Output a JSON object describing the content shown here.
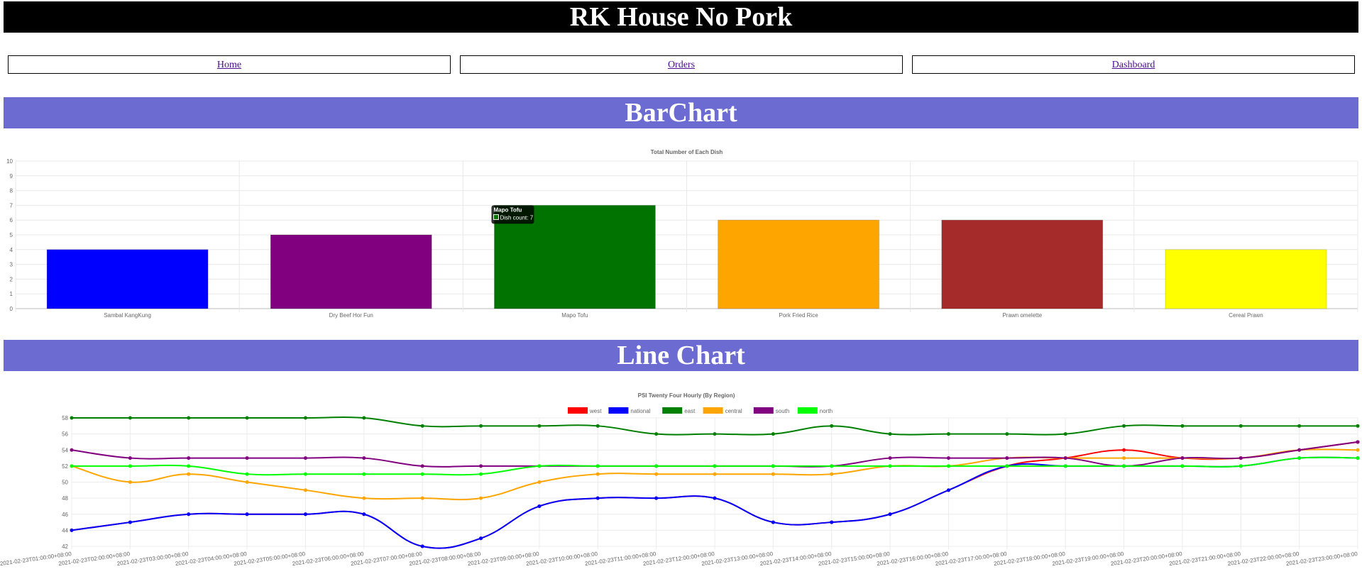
{
  "header": {
    "title": "RK House No Pork"
  },
  "nav": {
    "items": [
      {
        "label": "Home"
      },
      {
        "label": "Orders"
      },
      {
        "label": "Dashboard"
      }
    ]
  },
  "sections": {
    "bar_title": "BarChart",
    "line_title": "Line Chart"
  },
  "chart_data": [
    {
      "type": "bar",
      "title": "Total Number of Each Dish",
      "categories": [
        "Sambal KangKung",
        "Dry Beef Hor Fun",
        "Mapo Tofu",
        "Pork Fried Rice",
        "Prawn omelette",
        "Cereal Prawn"
      ],
      "series": [
        {
          "values": [
            4,
            5,
            7,
            6,
            6,
            4
          ]
        }
      ],
      "colors": [
        "#0000ff",
        "#800080",
        "#007300",
        "#ffa500",
        "#a52a2a",
        "#ffff00"
      ],
      "ylim": [
        0,
        10
      ],
      "yticks": [
        0,
        1,
        2,
        3,
        4,
        5,
        6,
        7,
        8,
        9,
        10
      ],
      "grid": true,
      "tooltip": {
        "title": "Mapo Tofu",
        "label": "Dish count: 7"
      }
    },
    {
      "type": "line",
      "title": "PSI Twenty Four Hourly (By Region)",
      "x": [
        "2021-02-23T01:00:00+08:00",
        "2021-02-23T02:00:00+08:00",
        "2021-02-23T03:00:00+08:00",
        "2021-02-23T04:00:00+08:00",
        "2021-02-23T05:00:00+08:00",
        "2021-02-23T06:00:00+08:00",
        "2021-02-23T07:00:00+08:00",
        "2021-02-23T08:00:00+08:00",
        "2021-02-23T09:00:00+08:00",
        "2021-02-23T10:00:00+08:00",
        "2021-02-23T11:00:00+08:00",
        "2021-02-23T12:00:00+08:00",
        "2021-02-23T13:00:00+08:00",
        "2021-02-23T14:00:00+08:00",
        "2021-02-23T15:00:00+08:00",
        "2021-02-23T16:00:00+08:00",
        "2021-02-23T17:00:00+08:00",
        "2021-02-23T18:00:00+08:00",
        "2021-02-23T19:00:00+08:00",
        "2021-02-23T20:00:00+08:00",
        "2021-02-23T21:00:00+08:00",
        "2021-02-23T22:00:00+08:00",
        "2021-02-23T23:00:00+08:00"
      ],
      "ylim": [
        42,
        58
      ],
      "yticks": [
        42,
        44,
        46,
        48,
        50,
        52,
        54,
        56,
        58
      ],
      "grid": true,
      "legend": "top",
      "series": [
        {
          "name": "west",
          "color": "#ff0000",
          "values": [
            44,
            45,
            46,
            46,
            46,
            46,
            42,
            43,
            47,
            48,
            48,
            48,
            45,
            45,
            46,
            49,
            52,
            53,
            54,
            53,
            53,
            54,
            55
          ]
        },
        {
          "name": "national",
          "color": "#0000ff",
          "values": [
            44,
            45,
            46,
            46,
            46,
            46,
            42,
            43,
            47,
            48,
            48,
            48,
            45,
            45,
            46,
            49,
            52,
            52,
            52,
            52,
            52,
            53,
            53
          ]
        },
        {
          "name": "east",
          "color": "#008000",
          "values": [
            58,
            58,
            58,
            58,
            58,
            58,
            57,
            57,
            57,
            57,
            56,
            56,
            56,
            57,
            56,
            56,
            56,
            56,
            57,
            57,
            57,
            57,
            57
          ]
        },
        {
          "name": "central",
          "color": "#ffa500",
          "values": [
            52,
            50,
            51,
            50,
            49,
            48,
            48,
            48,
            50,
            51,
            51,
            51,
            51,
            51,
            52,
            52,
            53,
            53,
            53,
            53,
            53,
            54,
            54
          ]
        },
        {
          "name": "south",
          "color": "#800080",
          "values": [
            54,
            53,
            53,
            53,
            53,
            53,
            52,
            52,
            52,
            52,
            52,
            52,
            52,
            52,
            53,
            53,
            53,
            53,
            52,
            53,
            53,
            54,
            55
          ]
        },
        {
          "name": "north",
          "color": "#00ff00",
          "values": [
            52,
            52,
            52,
            51,
            51,
            51,
            51,
            51,
            52,
            52,
            52,
            52,
            52,
            52,
            52,
            52,
            52,
            52,
            52,
            52,
            52,
            53,
            53
          ]
        }
      ]
    }
  ]
}
